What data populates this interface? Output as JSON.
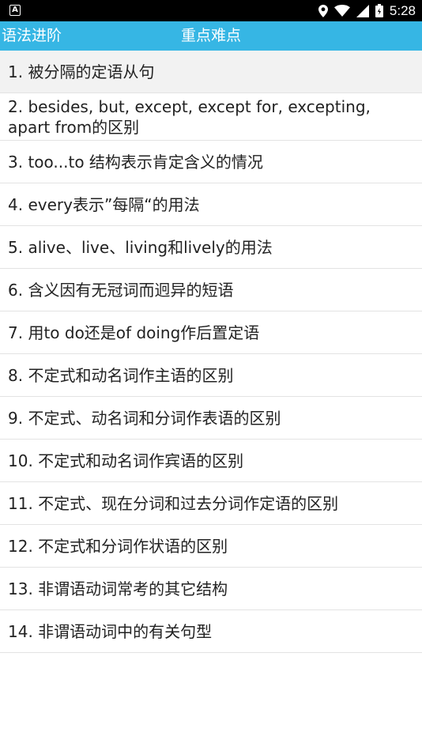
{
  "status_bar": {
    "notification_glyph": "A",
    "icons": [
      "location-icon",
      "wifi-icon",
      "cell-signal-icon",
      "battery-icon"
    ],
    "time": "5:28"
  },
  "app_bar": {
    "back_label": "语法进阶",
    "title": "重点难点",
    "color": "#36b6e4"
  },
  "topics": [
    "1. 被分隔的定语从句",
    "2. besides, but, except, except for, excepting, apart from的区别",
    "3. too...to 结构表示肯定含义的情况",
    "4. every表示”每隔“的用法",
    "5. alive、live、living和lively的用法",
    "6. 含义因有无冠词而迥异的短语",
    "7. 用to do还是of doing作后置定语",
    "8. 不定式和动名词作主语的区别",
    "9. 不定式、动名词和分词作表语的区别",
    "10. 不定式和动名词作宾语的区别",
    "11. 不定式、现在分词和过去分词作定语的区别",
    "12. 不定式和分词作状语的区别",
    "13. 非谓语动词常考的其它结构",
    "14. 非谓语动词中的有关句型"
  ]
}
